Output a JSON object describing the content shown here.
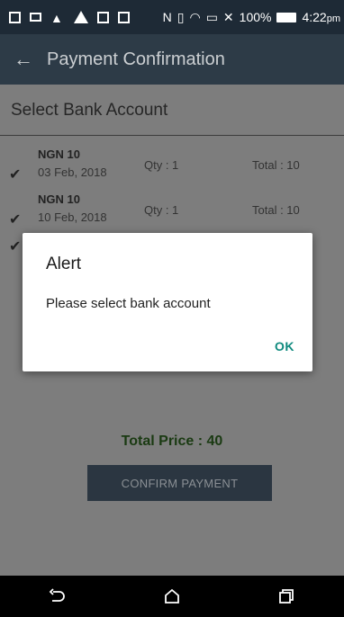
{
  "status_bar": {
    "signal": "✕",
    "battery_percent": "100%",
    "time": "4:22",
    "ampm": "pm"
  },
  "app_bar": {
    "title": "Payment Confirmation"
  },
  "section_title": "Select Bank Account",
  "items": [
    {
      "code": "NGN 10",
      "date": "03 Feb, 2018",
      "qty": "Qty : 1",
      "total": "Total : 10"
    },
    {
      "code": "NGN 10",
      "date": "10 Feb, 2018",
      "qty": "Qty : 1",
      "total": "Total : 10"
    }
  ],
  "total_price": "Total Price : 40",
  "confirm_button": "CONFIRM PAYMENT",
  "dialog": {
    "title": "Alert",
    "message": "Please select bank account",
    "ok": "OK"
  }
}
